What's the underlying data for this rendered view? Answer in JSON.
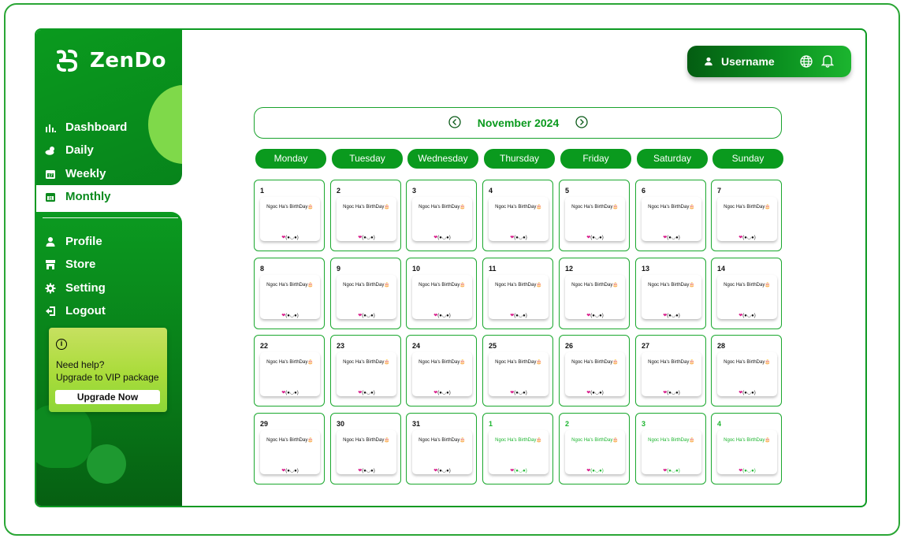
{
  "brand": {
    "name": "ZenDo"
  },
  "nav": {
    "primary": [
      {
        "label": "Dashboard",
        "icon": "chart-icon"
      },
      {
        "label": "Daily",
        "icon": "weather-icon"
      },
      {
        "label": "Weekly",
        "icon": "calendar-icon"
      },
      {
        "label": "Monthly",
        "icon": "calendar-icon",
        "active": true
      }
    ],
    "secondary": [
      {
        "label": "Profile",
        "icon": "user-icon"
      },
      {
        "label": "Store",
        "icon": "store-icon"
      },
      {
        "label": "Setting",
        "icon": "gear-icon"
      },
      {
        "label": "Logout",
        "icon": "logout-icon"
      }
    ]
  },
  "help": {
    "line1": "Need help?",
    "line2": "Upgrade to VIP package",
    "button": "Upgrade Now"
  },
  "header": {
    "username": "Username"
  },
  "calendar": {
    "month_label": "November 2024",
    "weekdays": [
      "Monday",
      "Tuesday",
      "Wednesday",
      "Thursday",
      "Friday",
      "Saturday",
      "Sunday"
    ],
    "event_text": "Ngoc Ha's BirthDay🎂",
    "kaomoji": "❤(●◡●)",
    "days": [
      "1",
      "2",
      "3",
      "4",
      "5",
      "6",
      "7",
      "8",
      "9",
      "10",
      "11",
      "12",
      "13",
      "14",
      "22",
      "23",
      "24",
      "25",
      "26",
      "27",
      "28",
      "29",
      "30",
      "31",
      "1",
      "2",
      "3",
      "4"
    ],
    "next_month_start_index": 24
  },
  "colors": {
    "primary": "#0a9a1e",
    "accent": "#7fd94a",
    "heart": "#d81b8a"
  }
}
